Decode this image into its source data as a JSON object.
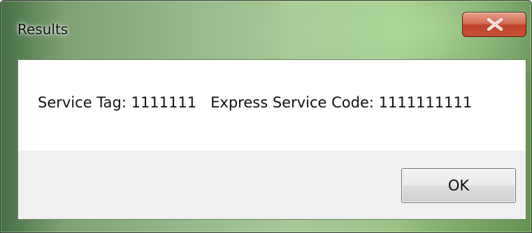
{
  "window": {
    "title": "Results"
  },
  "title_bar": {
    "close_icon": "close-x-icon",
    "close_button_color": "#c9513a"
  },
  "message": {
    "text": "Service Tag: 1111111   Express Service Code: 1111111111"
  },
  "buttons": {
    "ok_label": "OK"
  }
}
